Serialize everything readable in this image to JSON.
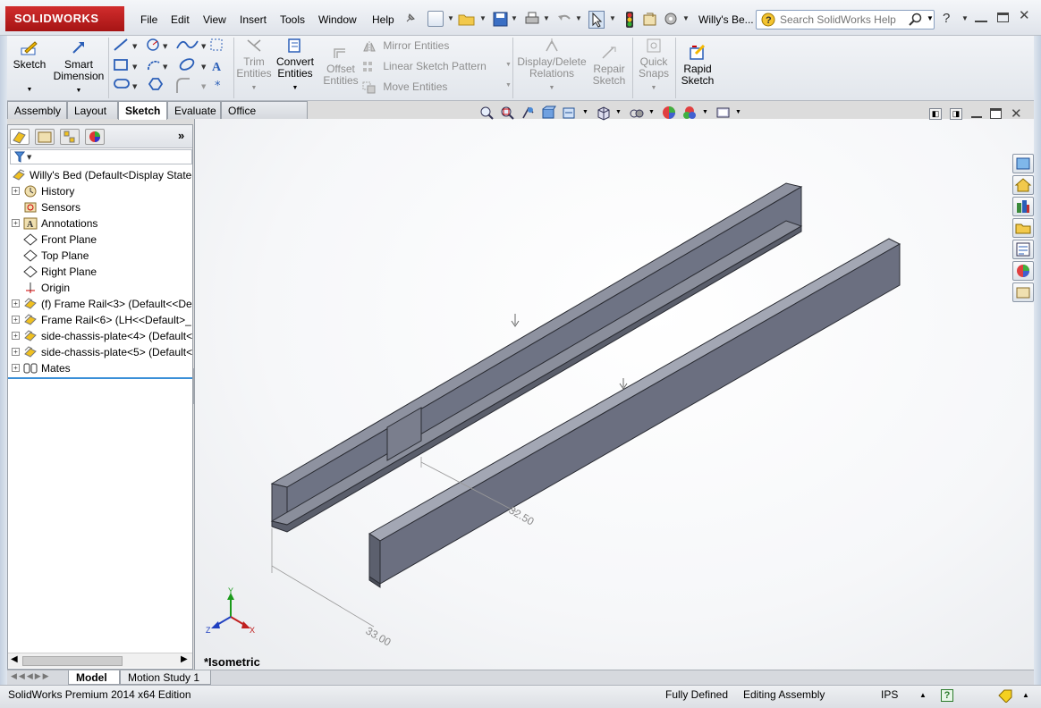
{
  "app": {
    "logo": "SOLIDWORKS",
    "doc_title": "Willy's Be..."
  },
  "menu": [
    "File",
    "Edit",
    "View",
    "Insert",
    "Tools",
    "Window",
    "Help"
  ],
  "help_search": {
    "placeholder": "Search SolidWorks Help"
  },
  "command_manager": {
    "sketch": "Sketch",
    "smart_dimension": [
      "Smart",
      "Dimension"
    ],
    "trim_entities": [
      "Trim",
      "Entities"
    ],
    "convert_entities": [
      "Convert",
      "Entities"
    ],
    "offset_entities": [
      "Offset",
      "Entities"
    ],
    "mirror_entities": "Mirror Entities",
    "linear_sketch_pattern": "Linear Sketch Pattern",
    "move_entities": "Move Entities",
    "display_delete_relations": [
      "Display/Delete",
      "Relations"
    ],
    "repair_sketch": [
      "Repair",
      "Sketch"
    ],
    "quick_snaps": [
      "Quick",
      "Snaps"
    ],
    "rapid_sketch": [
      "Rapid",
      "Sketch"
    ]
  },
  "tabs": [
    "Assembly",
    "Layout",
    "Sketch",
    "Evaluate",
    "Office Products"
  ],
  "active_tab": "Sketch",
  "feature_tree": {
    "root": "Willy's Bed  (Default<Display State-",
    "items": [
      {
        "label": "History",
        "icon": "history-icon",
        "expandable": true
      },
      {
        "label": "Sensors",
        "icon": "sensors-icon",
        "expandable": false
      },
      {
        "label": "Annotations",
        "icon": "annotations-icon",
        "expandable": true
      },
      {
        "label": "Front Plane",
        "icon": "plane-icon",
        "expandable": false
      },
      {
        "label": "Top Plane",
        "icon": "plane-icon",
        "expandable": false
      },
      {
        "label": "Right Plane",
        "icon": "plane-icon",
        "expandable": false
      },
      {
        "label": "Origin",
        "icon": "origin-icon",
        "expandable": false
      },
      {
        "label": "(f) Frame Rail<3> (Default<<De",
        "icon": "part-icon",
        "expandable": true
      },
      {
        "label": "Frame Rail<6> (LH<<Default>_",
        "icon": "part-icon",
        "expandable": true
      },
      {
        "label": "side-chassis-plate<4> (Default<",
        "icon": "part-icon",
        "expandable": true
      },
      {
        "label": "side-chassis-plate<5> (Default<",
        "icon": "part-icon",
        "expandable": true
      },
      {
        "label": "Mates",
        "icon": "mates-icon",
        "expandable": true
      }
    ]
  },
  "viewport": {
    "view_label": "*Isometric",
    "dim_1": "33.00",
    "dim_2": "32.50",
    "triad": {
      "x": "X",
      "y": "Y",
      "z": "Z"
    }
  },
  "bottom_tabs": [
    "Model",
    "Motion Study 1"
  ],
  "status": {
    "edition": "SolidWorks Premium 2014 x64 Edition",
    "state": "Fully Defined",
    "mode": "Editing Assembly",
    "units": "IPS"
  },
  "colors": {
    "accent_red": "#c0201f",
    "rail": "#6e7384"
  }
}
